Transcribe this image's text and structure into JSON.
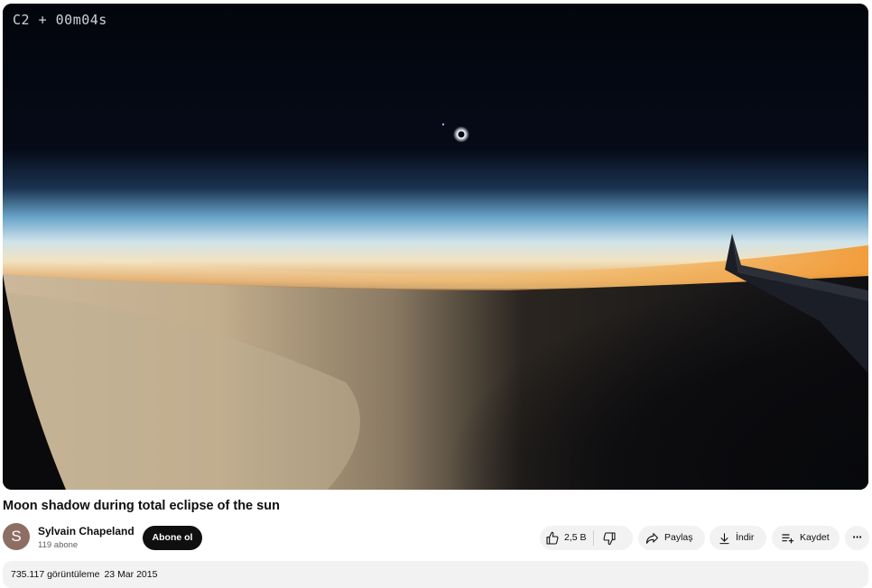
{
  "video": {
    "overlay_timer": "C2 + 00m04s",
    "title": "Moon shadow during total eclipse of the sun"
  },
  "channel": {
    "avatar_letter": "S",
    "name": "Sylvain Chapeland",
    "subscribers": "119 abone",
    "subscribe_label": "Abone ol"
  },
  "actions": {
    "like_count": "2,5 B",
    "share_label": "Paylaş",
    "download_label": "İndir",
    "save_label": "Kaydet",
    "more_label": "⋯"
  },
  "description": {
    "views": "735.117 görüntüleme",
    "date": "23 Mar 2015"
  },
  "colors": {
    "subscribe_bg": "#0f0f0f",
    "pill_bg": "#f2f2f2",
    "avatar_bg": "#8d6e63"
  }
}
